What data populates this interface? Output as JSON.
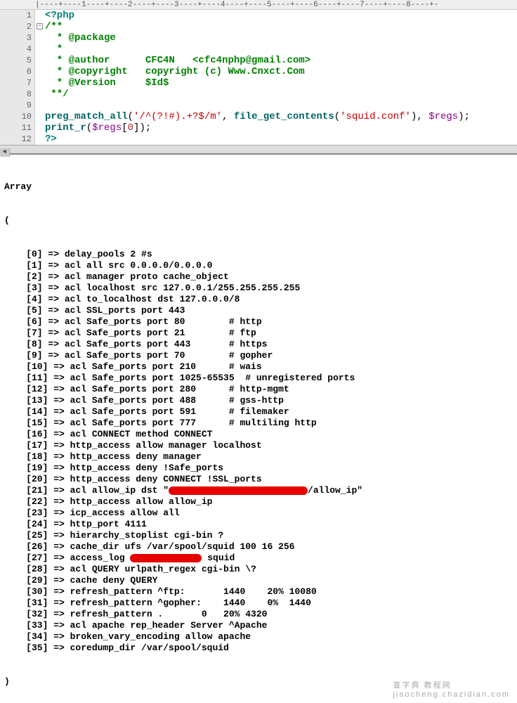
{
  "ruler": "|----+----1----+----2----+----3----+----4----+----5----+----6----+----7----+----8----+-",
  "gutter": {
    "numbers": [
      "1",
      "2",
      "3",
      "4",
      "5",
      "6",
      "7",
      "8",
      "9",
      "10",
      "11",
      "12"
    ],
    "fold_at": 2,
    "fold_symbol": "−"
  },
  "code": [
    [
      {
        "t": "<?php",
        "c": "c-aqua c-bold"
      }
    ],
    [
      {
        "t": "/**",
        "c": "c-green"
      }
    ],
    [
      {
        "t": "  * @package",
        "c": "c-green"
      }
    ],
    [
      {
        "t": "  *",
        "c": "c-green"
      }
    ],
    [
      {
        "t": "  * @author      CFC4N   <cfc4nphp@gmail.com>",
        "c": "c-green"
      }
    ],
    [
      {
        "t": "  * @copyright   copyright (c) Www.Cnxct.Com",
        "c": "c-green"
      }
    ],
    [
      {
        "t": "  * @Version     $Id$",
        "c": "c-green"
      }
    ],
    [
      {
        "t": " **/",
        "c": "c-green"
      }
    ],
    [
      {
        "t": "",
        "c": ""
      }
    ],
    [
      {
        "t": "preg_match_all",
        "c": "c-darkteal"
      },
      {
        "t": "(",
        "c": ""
      },
      {
        "t": "'/^(?!#).+?$/m'",
        "c": "c-red"
      },
      {
        "t": ", ",
        "c": ""
      },
      {
        "t": "file_get_contents",
        "c": "c-darkteal"
      },
      {
        "t": "(",
        "c": ""
      },
      {
        "t": "'squid.conf'",
        "c": "c-red"
      },
      {
        "t": "), ",
        "c": ""
      },
      {
        "t": "$regs",
        "c": "c-purple"
      },
      {
        "t": ");",
        "c": ""
      }
    ],
    [
      {
        "t": "print_r",
        "c": "c-darkteal"
      },
      {
        "t": "(",
        "c": ""
      },
      {
        "t": "$regs",
        "c": "c-purple"
      },
      {
        "t": "[",
        "c": ""
      },
      {
        "t": "0",
        "c": "c-darkred"
      },
      {
        "t": "]);",
        "c": ""
      }
    ],
    [
      {
        "t": "?>",
        "c": "c-aqua c-bold"
      }
    ]
  ],
  "scroll_arrow": "◄",
  "output_open": "Array",
  "output_paren_open": "(",
  "output_lines": [
    {
      "text": "    [0] => delay_pools 2 #s"
    },
    {
      "text": "    [1] => acl all src 0.0.0.0/0.0.0.0"
    },
    {
      "text": "    [2] => acl manager proto cache_object"
    },
    {
      "text": "    [3] => acl localhost src 127.0.0.1/255.255.255.255"
    },
    {
      "text": "    [4] => acl to_localhost dst 127.0.0.0/8"
    },
    {
      "text": "    [5] => acl SSL_ports port 443"
    },
    {
      "text": "    [6] => acl Safe_ports port 80        # http"
    },
    {
      "text": "    [7] => acl Safe_ports port 21        # ftp"
    },
    {
      "text": "    [8] => acl Safe_ports port 443       # https"
    },
    {
      "text": "    [9] => acl Safe_ports port 70        # gopher"
    },
    {
      "text": "    [10] => acl Safe_ports port 210      # wais"
    },
    {
      "text": "    [11] => acl Safe_ports port 1025-65535  # unregistered ports"
    },
    {
      "text": "    [12] => acl Safe_ports port 280      # http-mgmt"
    },
    {
      "text": "    [13] => acl Safe_ports port 488      # gss-http"
    },
    {
      "text": "    [14] => acl Safe_ports port 591      # filemaker"
    },
    {
      "text": "    [15] => acl Safe_ports port 777      # multiling http"
    },
    {
      "text": "    [16] => acl CONNECT method CONNECT"
    },
    {
      "text": "    [17] => http_access allow manager localhost"
    },
    {
      "text": "    [18] => http_access deny manager"
    },
    {
      "text": "    [19] => http_access deny !Safe_ports"
    },
    {
      "text": "    [20] => http_access deny CONNECT !SSL_ports"
    },
    {
      "text": "    [21] => acl allow_ip dst \"",
      "redact_width": 198,
      "after": "/allow_ip\""
    },
    {
      "text": "    [22] => http_access allow allow_ip"
    },
    {
      "text": "    [23] => icp_access allow all"
    },
    {
      "text": "    [24] => http_port 4111"
    },
    {
      "text": "    [25] => hierarchy_stoplist cgi-bin ?"
    },
    {
      "text": "    [26] => cache_dir ufs /var/spool/squid 100 16 256"
    },
    {
      "text": "    [27] => access_log ",
      "redact_width": 102,
      "after": " squid"
    },
    {
      "text": "    [28] => acl QUERY urlpath_regex cgi-bin \\?"
    },
    {
      "text": "    [29] => cache deny QUERY"
    },
    {
      "text": "    [30] => refresh_pattern ^ftp:       1440    20% 10080"
    },
    {
      "text": "    [31] => refresh_pattern ^gopher:    1440    0%  1440"
    },
    {
      "text": "    [32] => refresh_pattern .       0   20% 4320"
    },
    {
      "text": "    [33] => acl apache rep_header Server ^Apache"
    },
    {
      "text": "    [34] => broken_vary_encoding allow apache"
    },
    {
      "text": "    [35] => coredump_dir /var/spool/squid"
    }
  ],
  "output_paren_close": ")",
  "watermark": "查字典 教程网\njiaocheng.chazidian.com"
}
